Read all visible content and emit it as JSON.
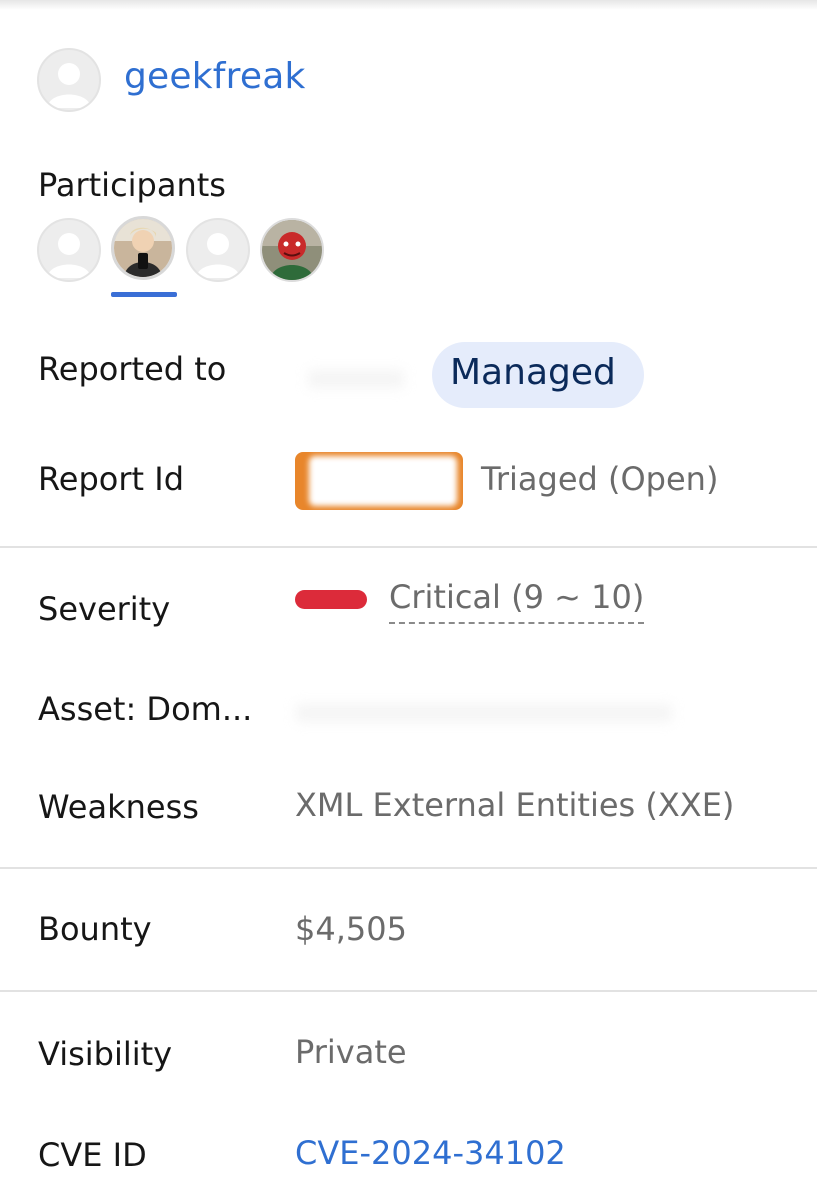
{
  "reporter": {
    "username": "geekfreak"
  },
  "participants": {
    "label": "Participants",
    "avatars": [
      "default-avatar-icon",
      "user-photo-avatar",
      "default-avatar-icon",
      "character-photo-avatar"
    ]
  },
  "reported_to": {
    "label": "Reported to",
    "badge": "Managed"
  },
  "report_id": {
    "label": "Report Id",
    "status": "Triaged (Open)"
  },
  "severity": {
    "label": "Severity",
    "value": "Critical (9 ~ 10)",
    "color": "#dc2b3a"
  },
  "asset": {
    "label": "Asset: Dom..."
  },
  "weakness": {
    "label": "Weakness",
    "value": "XML External Entities (XXE)"
  },
  "bounty": {
    "label": "Bounty",
    "value": "$4,505"
  },
  "visibility": {
    "label": "Visibility",
    "value": "Private"
  },
  "cve": {
    "label": "CVE ID",
    "value": "CVE-2024-34102"
  },
  "colors": {
    "link": "#2f6fd1",
    "badge_bg": "#e5ecfb",
    "report_box": "#e8862b"
  }
}
